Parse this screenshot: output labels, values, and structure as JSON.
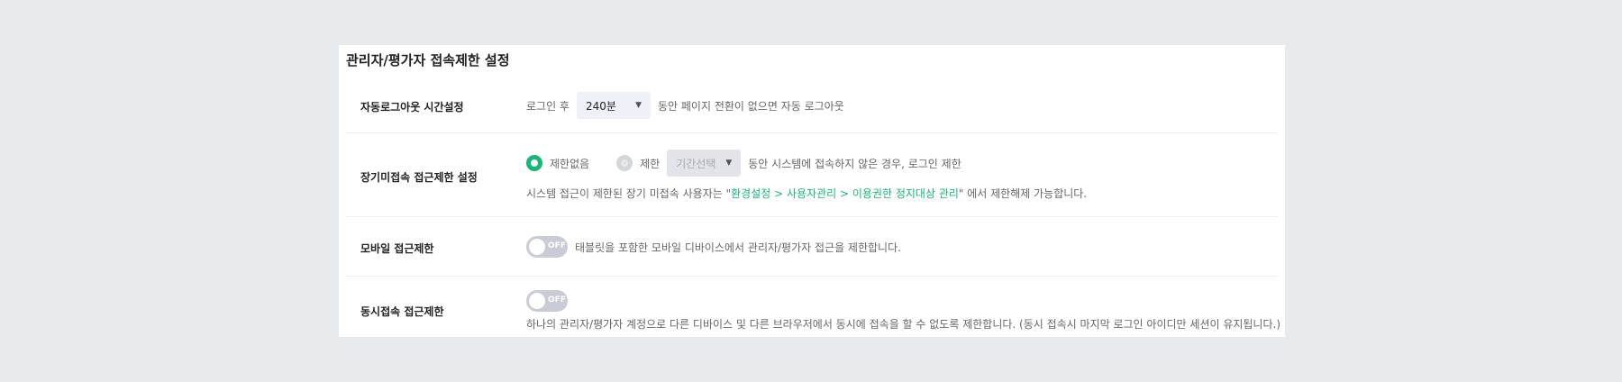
{
  "title": "관리자/평가자 접속제한 설정",
  "rows": {
    "autologout": {
      "label": "자동로그아웃 시간설정",
      "prefix": "로그인 후",
      "value": "240분",
      "suffix": "동안 페이지 전환이 없으면 자동 로그아웃"
    },
    "longterm": {
      "label": "장기미접속 접근제한 설정",
      "opt_none": "제한없음",
      "opt_limit": "제한",
      "period_placeholder": "기간선택",
      "suffix": "동안 시스템에 접속하지 않은 경우, 로그인 제한",
      "note_pre": "시스템 접근이 제한된 장기 미접속 사용자는 \"",
      "note_link": "환경설정 > 사용자관리 > 이용권한 정지대상 관리",
      "note_post": "\" 에서 제한해제 가능합니다."
    },
    "mobile": {
      "label": "모바일 접근제한",
      "toggle": "OFF",
      "desc": "태블릿을 포함한 모바일 디바이스에서 관리자/평가자 접근을 제한합니다."
    },
    "concurrent": {
      "label": "동시접속 접근제한",
      "toggle": "OFF",
      "desc": "하나의 관리자/평가자 계정으로 다른 디바이스 및 다른 브라우저에서 동시에 접속을 할 수 없도록 제한합니다. (동시 접속시 마지막 로그인 아이디만 세션이 유지됩니다.)"
    }
  },
  "colors": {
    "accent": "#16b874",
    "background": "#e8ebee"
  }
}
